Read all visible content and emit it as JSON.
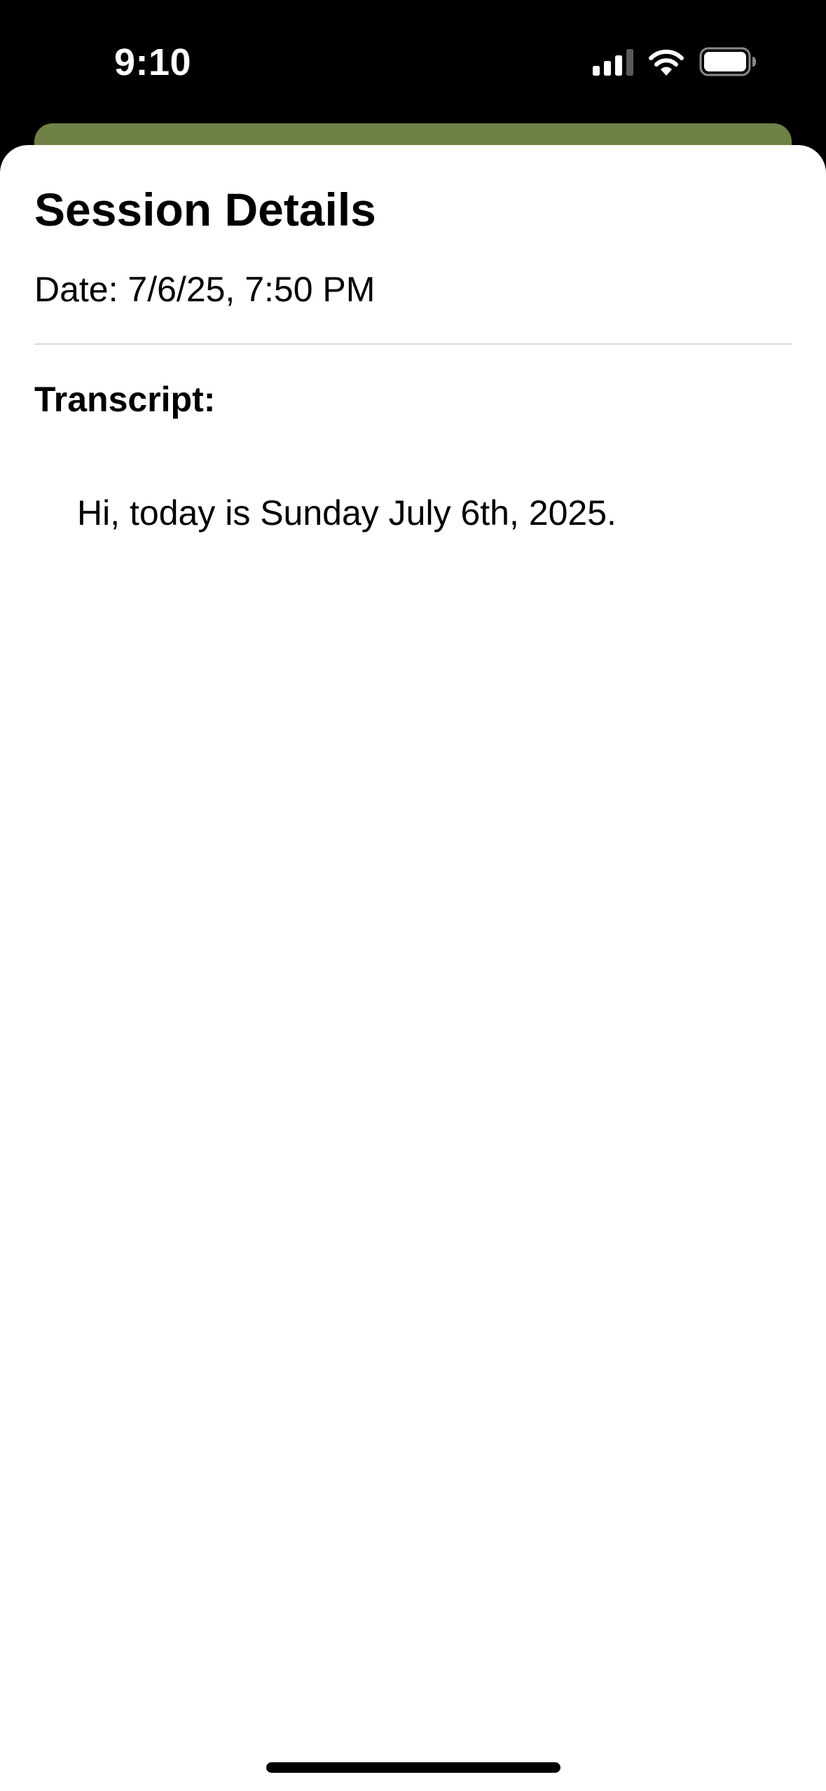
{
  "status_bar": {
    "time": "9:10",
    "icons": [
      "signal-icon",
      "wifi-icon",
      "battery-icon"
    ]
  },
  "colors": {
    "accent_card": "#6f8144",
    "sheet_background": "#ffffff",
    "divider": "#d9d9dc"
  },
  "sheet": {
    "title": "Session Details",
    "date_label": "Date:",
    "date_value": "7/6/25, 7:50 PM",
    "transcript_label": "Transcript:",
    "transcript_text": "Hi, today is Sunday July 6th, 2025."
  }
}
